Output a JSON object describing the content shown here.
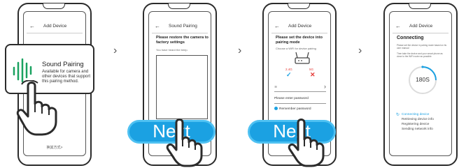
{
  "screens": [
    {
      "title": "Add Device",
      "card": {
        "title": "Sound Pairing",
        "description": "Available for camera and other devices that support this pairing method."
      },
      "footer": "换其方式>"
    },
    {
      "title": "Sound Pairing",
      "heading": "Please restore the camera to factory settings",
      "subtext": "You have heard the beep.",
      "button": "Next"
    },
    {
      "title": "Add Device",
      "heading": "Please set the device into pairing mode",
      "subtext": "Choose a WiFi for device pairing",
      "bands": [
        {
          "label": "2.4G",
          "status": "check"
        },
        {
          "label": "5G",
          "status": "cross"
        }
      ],
      "password_placeholder": "Please enter password",
      "remember_label": "Remember password",
      "button": "Next"
    },
    {
      "title": "Add Device",
      "heading": "Connecting",
      "subtext1": "Please set the device in pairing mode based on its user manual",
      "subtext2": "Then take the device and your smart phone as close to the WiFi router as possible",
      "countdown": "180S",
      "steps": [
        "Connecting device",
        "Retrieving device info",
        "Registering device",
        "Sending network info"
      ]
    }
  ],
  "colors": {
    "accent": "#1ba1e2",
    "success": "#1ba1e2",
    "error": "#e53935",
    "card_icon": "#1aa260"
  }
}
